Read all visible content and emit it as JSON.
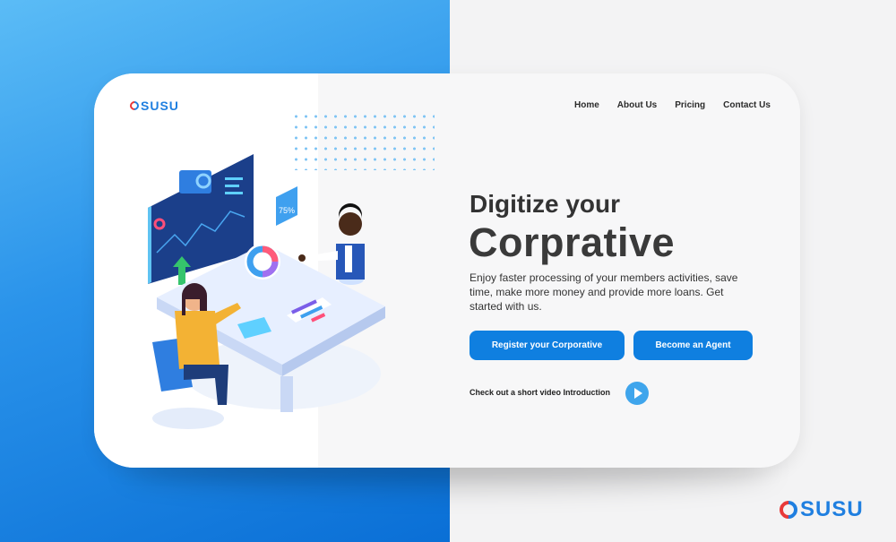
{
  "brand": {
    "name": "SUSU",
    "primary_color": "#0f7fe0",
    "accent_color": "#e83a3a"
  },
  "nav": {
    "items": [
      "Home",
      "About Us",
      "Pricing",
      "Contact Us"
    ]
  },
  "hero": {
    "title_line1": "Digitize your",
    "title_line2": "Corprative",
    "description": "Enjoy faster processing of your members activities, save time, make more money and provide more loans. Get started with us.",
    "primary_cta": "Register your Corporative",
    "secondary_cta": "Become an Agent",
    "video_text": "Check out a short video Introduction",
    "play_icon": "play-icon"
  },
  "illustration": {
    "chart_badge": "75%"
  }
}
